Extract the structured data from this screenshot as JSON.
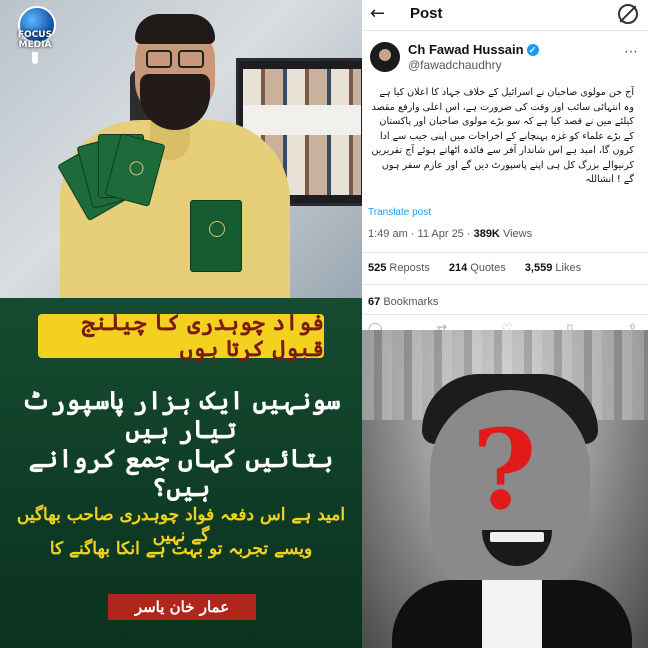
{
  "logo": {
    "text": "FOCUS MEDIA"
  },
  "headline": "فواد چوہدری کا چیلنج قبول کرتا ہوں",
  "quote_line1": "سونہیں ایک ہزار پاسپورٹ تیار ہیں",
  "quote_line2": "بتائیں کہاں جمع کروانے ہیں؟",
  "sub_line1": "امید ہے اس دفعہ فواد چوہدری صاحب بھاگیں گے نہیں",
  "sub_line2": "ویسے تجربہ تو بہت ہے انکا بھاگنے کا",
  "author": "عمار خان یاسر",
  "post": {
    "title": "Post",
    "name": "Ch Fawad Hussain",
    "handle": "@fawadchaudhry",
    "body": "آج جن مولوی صاحبان نے اسرائیل کے خلاف جہاد کا اعلان کیا ہے وہ انتہائی سائب اور وقت کی ضرورت ہے، اس اعلی وارفع مقصد کیلئے میں نے قصد کیا ہے کہ سو بڑے مولوی صاحبان اور پاکستان کے بڑے علماء کو غزہ پہنچانے کے اخراجات میں اپنی جیب سے ادا کروں گا، امید ہے اس شاندار آفر سے فائدہ اٹھاتے ہوئے آج تقریریں کرنیوالے بزرگ کل ہی اپنے پاسپورٹ دیں گے اور عازم سفر ہوں گے ! انشاللہ",
    "translate": "Translate post",
    "time": "1:49 am · 11 Apr 25 · ",
    "views_count": "389K",
    "views_label": "Views",
    "reposts_count": "525",
    "reposts_label": "Reposts",
    "quotes_count": "214",
    "quotes_label": "Quotes",
    "likes_count": "3,559",
    "likes_label": "Likes",
    "bookmarks_count": "67",
    "bookmarks_label": "Bookmarks"
  },
  "icons": {
    "back": "arrow-left-icon",
    "header_right": "slashed-circle-icon",
    "verified": "verified-badge-icon",
    "more": "more-icon",
    "reply": "reply-icon",
    "repost": "repost-icon",
    "like": "heart-icon",
    "bookmark": "bookmark-icon",
    "share": "share-icon"
  },
  "colors": {
    "green_bg": "#0e3b26",
    "yellow": "#f2d21e",
    "red_label": "#b0261b",
    "question_mark": "#e11a1a",
    "link_blue": "#1d9bf0"
  }
}
